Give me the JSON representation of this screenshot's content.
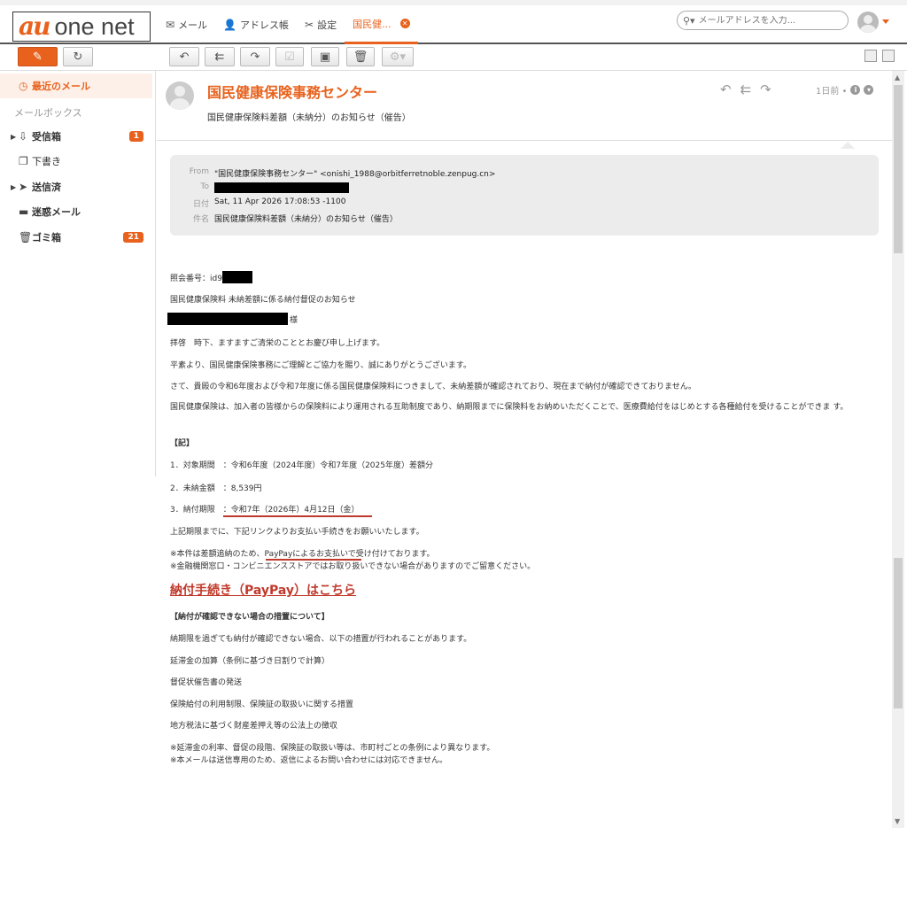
{
  "logo": {
    "au": "au",
    "onenet": "one net"
  },
  "nav": {
    "mail": "メール",
    "address": "アドレス帳",
    "settings": "設定",
    "tab": "国民健..."
  },
  "search": {
    "placeholder": "メールアドレスを入力..."
  },
  "sidebar": {
    "recent": "最近のメール",
    "mailbox_label": "メールボックス",
    "items": [
      {
        "label": "受信箱",
        "badge": "1"
      },
      {
        "label": "下書き"
      },
      {
        "label": "送信済"
      },
      {
        "label": "迷惑メール"
      },
      {
        "label": "ゴミ箱",
        "badge": "21"
      }
    ]
  },
  "message": {
    "sender": "国民健康保険事務センター",
    "subject": "国民健康保険料差額（未納分）のお知らせ（催告）",
    "time": "1日前 •"
  },
  "headers": {
    "from_key": "From",
    "from_val": "\"国民健康保険事務センター\" <onishi_1988@orbitferretnoble.zenpug.cn>",
    "to_key": "To",
    "date_key": "日付",
    "date_val": "Sat, 11 Apr 2026 17:08:53 -1100",
    "subj_key": "件名",
    "subj_val": "国民健康保険料差額（未納分）のお知らせ（催告）"
  },
  "body": {
    "ref": "照会番号：id9",
    "title": "国民健康保険料 未納差額に係る納付督促のお知らせ",
    "sama": "様",
    "l1": "拝啓　時下、ますますご清栄のこととお慶び申し上げます。",
    "l2": "平素より、国民健康保険事務にご理解とご協力を賜り、誠にありがとうございます。",
    "l3": "さて、貴殿の令和6年度および令和7年度に係る国民健康保険料につきまして、未納差額が確認されており、現在まで納付が確認できておりません。",
    "l4": "国民健康保険は、加入者の皆様からの保険料により運用される互助制度であり、納期限までに保険料をお納めいただくことで、医療費給付をはじめとする各種給付を受けることができま す。",
    "ki": "【記】",
    "item1": "1．対象期間　：令和6年度（2024年度）令和7年度（2025年度）差額分",
    "item2": "2．未納金額　：8,539円",
    "item3": "3．納付期限　：令和7年（2026年）4月12日（金）",
    "l5": "上記期限までに、下記リンクよりお支払い手続きをお願いいたします。",
    "note1": "※本件は差額追納のため、PayPayによるお支払いで受け付けております。",
    "note2": "※金融機関窓口・コンビニエンスストアではお取り扱いできない場合がありますのでご留意ください。",
    "link": "納付手続き（PayPay）はこちら",
    "measures_title": "【納付が確認できない場合の措置について】",
    "m0": "納期限を過ぎても納付が確認できない場合、以下の措置が行われることがあります。",
    "m1": "延滞金の加算（条例に基づき日割りで計算）",
    "m2": "督促状催告書の発送",
    "m3": "保険給付の利用制限、保険証の取扱いに関する措置",
    "m4": "地方税法に基づく財産差押え等の公法上の徴収",
    "foot1": "※延滞金の利率、督促の段階、保険証の取扱い等は、市町村ごとの条例により異なります。",
    "foot2": "※本メールは送信専用のため、返信によるお問い合わせには対応できません。"
  }
}
